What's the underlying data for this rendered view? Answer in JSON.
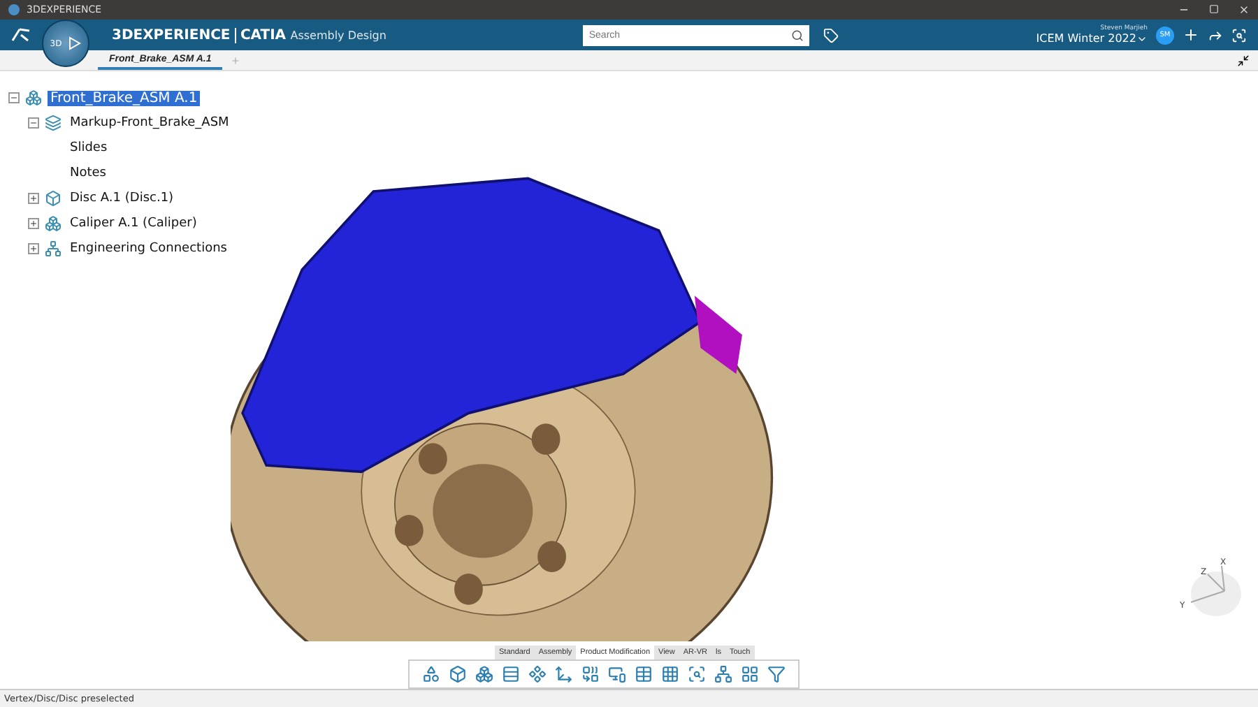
{
  "window": {
    "title": "3DEXPERIENCE"
  },
  "header": {
    "brand": "3DEXPERIENCE",
    "app": "CATIA",
    "module": "Assembly Design",
    "compass_label": "3D",
    "search": {
      "placeholder": "Search"
    },
    "user": "Steven Marjieh",
    "workspace": "ICEM Winter 2022",
    "avatar": "SM"
  },
  "tabs": [
    {
      "label": "Front_Brake_ASM A.1",
      "selected": true
    }
  ],
  "tree": [
    {
      "label": "Front_Brake_ASM A.1",
      "selected": true,
      "expanded": true,
      "kind": "product",
      "children": [
        {
          "label": "Markup-Front_Brake_ASM",
          "selected": false,
          "expanded": true,
          "kind": "markup",
          "children": [
            {
              "label": "Slides",
              "selected": false,
              "kind": "leaf"
            },
            {
              "label": "Notes",
              "selected": false,
              "kind": "leaf"
            }
          ]
        },
        {
          "label": "Disc A.1 (Disc.1)",
          "selected": false,
          "expanded": false,
          "kind": "part"
        },
        {
          "label": "Caliper A.1 (Caliper)",
          "selected": false,
          "expanded": false,
          "kind": "product"
        },
        {
          "label": "Engineering Connections",
          "selected": false,
          "expanded": false,
          "kind": "connections"
        }
      ]
    }
  ],
  "compass": {
    "axes": [
      "X",
      "Z",
      "Y"
    ]
  },
  "action_bar": {
    "sections": [
      {
        "label": "Standard",
        "selected": false
      },
      {
        "label": "Assembly",
        "selected": false
      },
      {
        "label": "Product Modification",
        "selected": true
      },
      {
        "label": "View",
        "selected": false
      },
      {
        "label": "AR-VR",
        "selected": false
      },
      {
        "label": "ls",
        "selected": false
      },
      {
        "label": "Touch",
        "selected": false
      }
    ]
  },
  "status_bar": {
    "message": "Vertex/Disc/Disc preselected"
  }
}
